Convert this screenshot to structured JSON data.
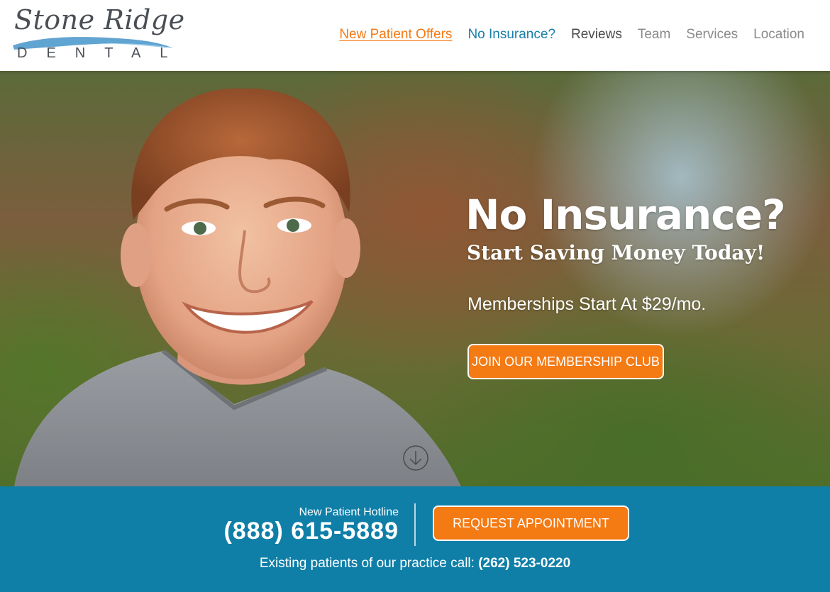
{
  "logo": {
    "script": "Stone Ridge",
    "sub": "DENTAL"
  },
  "nav": {
    "items": [
      {
        "label": "New Patient Offers",
        "color": "#f47a14"
      },
      {
        "label": "No Insurance?",
        "color": "#1a7fa8"
      },
      {
        "label": "Reviews",
        "color": "#4a4a4a"
      },
      {
        "label": "Team",
        "color": "#8a8a8a"
      },
      {
        "label": "Services",
        "color": "#8a8a8a"
      },
      {
        "label": "Location",
        "color": "#8a8a8a"
      }
    ]
  },
  "hero": {
    "title": "No Insurance?",
    "subtitle": "Start Saving Money Today!",
    "tagline": "Memberships Start At $29/mo.",
    "cta_label": "JOIN OUR MEMBERSHIP CLUB",
    "scroll_icon": "arrow-down-circle-icon"
  },
  "contact": {
    "hotline_label": "New Patient Hotline",
    "hotline_number": "(888) 615-5889",
    "request_label": "REQUEST APPOINTMENT",
    "existing_text": "Existing patients of our practice call:",
    "existing_phone": "(262) 523-0220"
  },
  "colors": {
    "accent_orange": "#f47a14",
    "brand_blue": "#0f7fa8"
  }
}
